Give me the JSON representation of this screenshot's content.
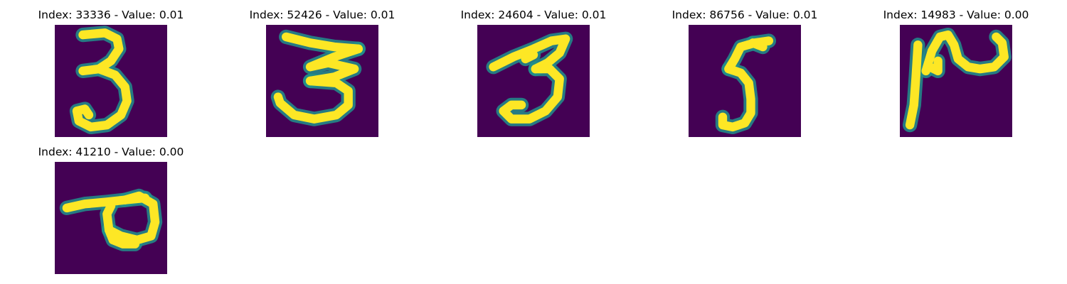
{
  "panels": [
    {
      "title": "Index: 33336 - Value: 0.01",
      "depicted_digit": "3"
    },
    {
      "title": "Index: 52426 - Value: 0.01",
      "depicted_digit": "3"
    },
    {
      "title": "Index: 24604 - Value: 0.01",
      "depicted_digit": "3"
    },
    {
      "title": "Index: 86756 - Value: 0.01",
      "depicted_digit": "5"
    },
    {
      "title": "Index: 14983 - Value: 0.00",
      "depicted_digit": "2"
    },
    {
      "title": "Index: 41210 - Value: 0.00",
      "depicted_digit": "9"
    }
  ],
  "colors": {
    "background": "#440154",
    "mid": "#21918c",
    "high": "#fde725",
    "page": "#ffffff"
  }
}
